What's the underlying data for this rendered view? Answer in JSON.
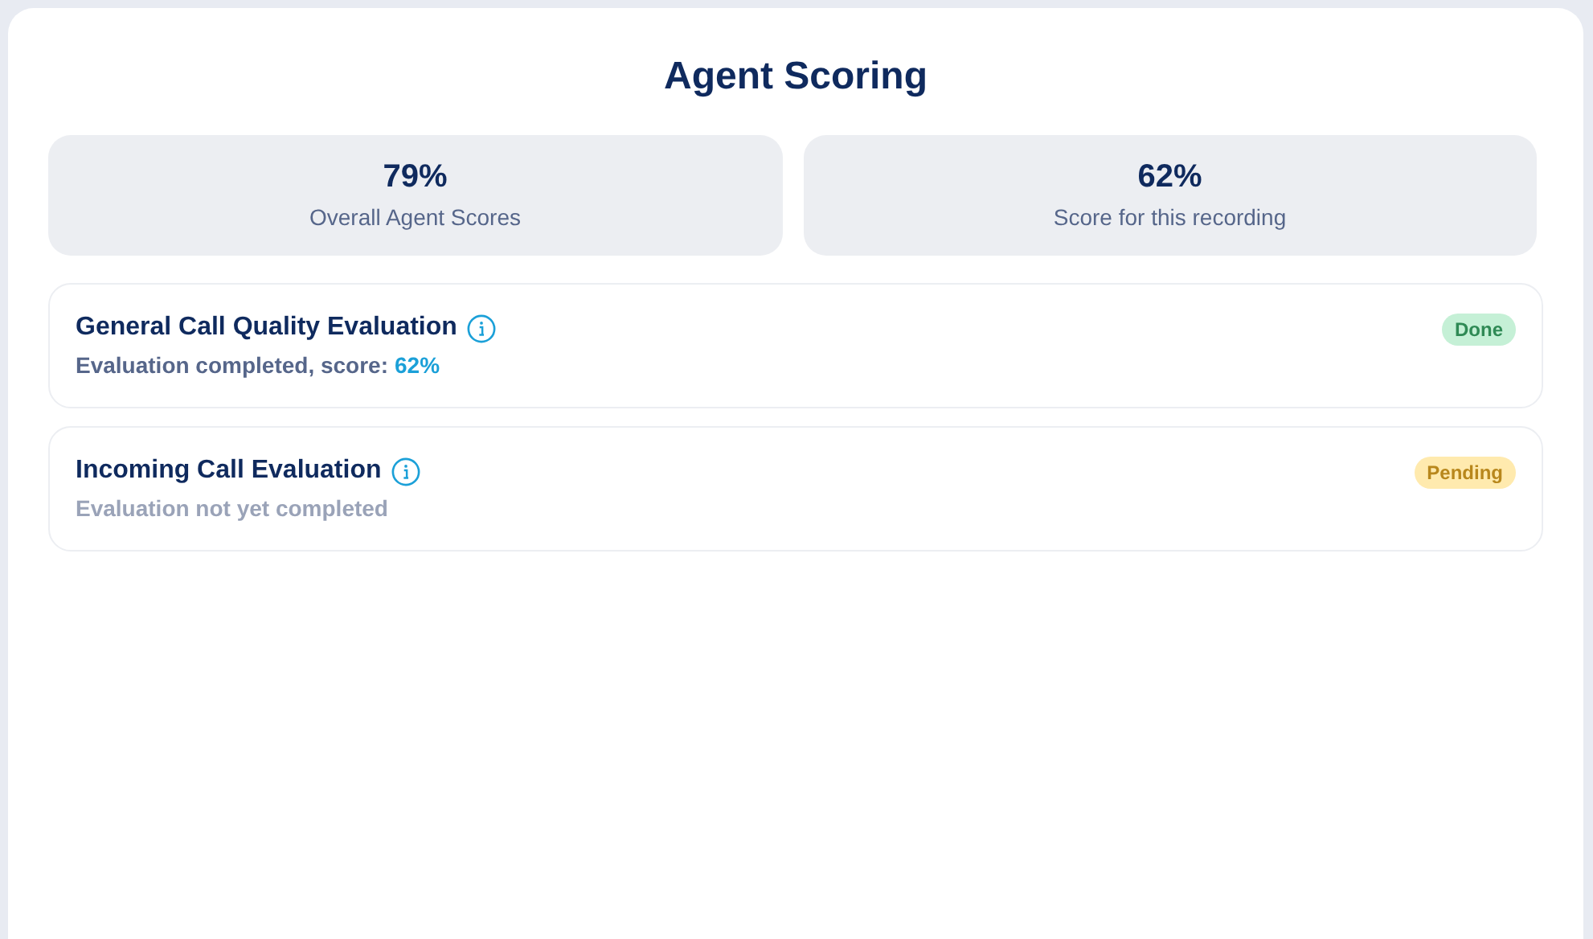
{
  "title": "Agent Scoring",
  "stats": [
    {
      "value": "79%",
      "label": "Overall Agent Scores"
    },
    {
      "value": "62%",
      "label": "Score for this recording"
    }
  ],
  "evaluations": [
    {
      "title": "General Call Quality Evaluation",
      "description": "Evaluation completed, score:",
      "score": "62%",
      "status": {
        "kind": "done",
        "label": "Done"
      }
    },
    {
      "title": "Incoming Call Evaluation",
      "description": "Evaluation not yet completed",
      "status": {
        "kind": "pending",
        "label": "Pending"
      }
    }
  ]
}
